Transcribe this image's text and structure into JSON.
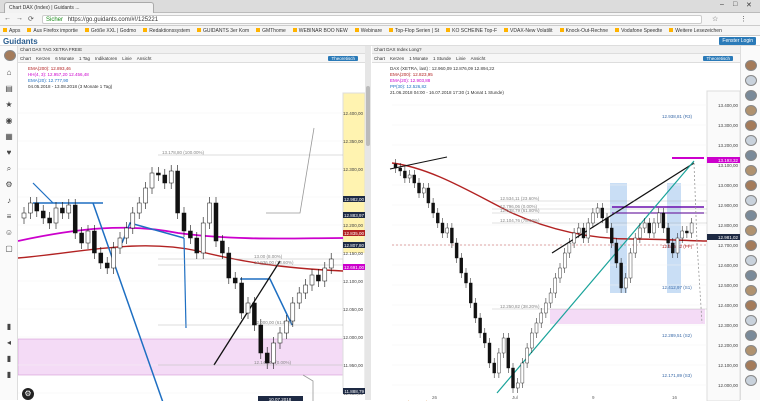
{
  "browser": {
    "tab_title": "Chart DAX (Index) | Guidants ...",
    "url": "https://go.guidants.com/#!/125221",
    "secure_label": "Sicher",
    "bookmarks": [
      "Apps",
      "Aus Firefox importie",
      "Größe XXL | Godmo",
      "Redaktionssystem",
      "GUIDANTS 3er Kom",
      "GMThome",
      "WEBINAR BOO NEW",
      "Webinare",
      "Top-Flop Serien | St",
      "KO SCHEINE Top-F",
      "VDAX-New Volatilit",
      "Knock-Out-Rechne",
      "Vodafone Speedte",
      "Weitere Lesezeichen"
    ]
  },
  "app": {
    "logo": "Guidants",
    "new_layout_button": "Fenster Login",
    "tabs": [
      "Desktops",
      "Seite",
      "Desktop"
    ]
  },
  "left_chart": {
    "toolbar": [
      "Chart",
      "Kerzen",
      "6 Monate",
      "1 Tag",
      "Indikatoren",
      "Linie",
      "Ansicht"
    ],
    "blue_chip": "Theoretisch",
    "indicators": [
      "EMA(200): 12.893,46",
      "HH(4, 3): 12.957,20  12.456,48",
      "EMA(20): 12.777,90"
    ],
    "date_line": "04.05.2018 - 13.08.2018 (3 Monate 1 Tag)",
    "price_labels": [
      "12.400,00",
      "12.350,00",
      "12.300,00",
      "12.250,00",
      "12.200,00",
      "12.150,00",
      "12.100,00",
      "12.050,00",
      "12.000,00",
      "11.950,00",
      "11.900,00"
    ],
    "highlight_labels": [
      "12.982,00",
      "12.883,97",
      "12.835,00",
      "12.807,80",
      "12.691,00",
      "11.888,79"
    ],
    "date_tag": "10.07.2018",
    "note": "DAX: Nachbemerkte größer Bedeutung",
    "fib_labels": [
      "13.178,80 (100.00%)",
      "13.00 (8.00%)",
      "12.936,00 (78.60%)",
      "12.000,00 (61.80%)",
      "12.145,40 (0.00%)"
    ],
    "xaxis": [
      "Mai",
      "Jun",
      "Jul"
    ]
  },
  "right_chart": {
    "toolbar": [
      "Chart",
      "Kerzen",
      "1 Monate",
      "1 Stunde",
      "Linie",
      "Ansicht"
    ],
    "blue_chip": "Theoretisch",
    "header_title": "Chart DAX Index Long?",
    "indicators": [
      "DAX (XETRA, last) : 12.960,09  12.876,09  12.894,22",
      "EMA(200): 12.823,95",
      "EMA(20): 12.903,88",
      "PP(30): 12.526,82"
    ],
    "date_line": "21.06.2018 04:00 - 16.07.2018 17:30 (1 Monat 1 Stunde)",
    "price_labels": [
      "13.400,00",
      "13.300,00",
      "13.200,00",
      "13.100,00",
      "13.000,00",
      "12.900,00",
      "12.800,00",
      "12.700,00",
      "12.600,00",
      "12.500,00",
      "12.400,00",
      "12.300,00",
      "12.200,00",
      "12.100,00",
      "12.000,00"
    ],
    "level_labels": [
      "12.938,81 (R3)",
      "12.526,82 (PP)",
      "12.412,97 (S1)",
      "12.289,51 (S2)",
      "12.171,89 (S3)"
    ],
    "highlight_labels": [
      "13.193,32",
      "12.981,02"
    ],
    "fib_labels": [
      "12.796,06 (0.00%)",
      "12.638,79 (61.80%)",
      "12.250,82 (38.20%)",
      "12.104,76 (78.60%)",
      "12.534,11 (23.60%)"
    ],
    "macd": "MACD(12, 26, 9): 17,59  8,61",
    "xaxis": [
      "26",
      "Jul",
      "9",
      "16"
    ]
  },
  "colors": {
    "red_ema": "#b22222",
    "magenta_ema": "#cc00cc",
    "blue_line": "#1e6fc2",
    "highlight_pink": "#f4dbf6",
    "highlight_yellow": "#fff3b0",
    "brand": "#2a5d8f"
  }
}
